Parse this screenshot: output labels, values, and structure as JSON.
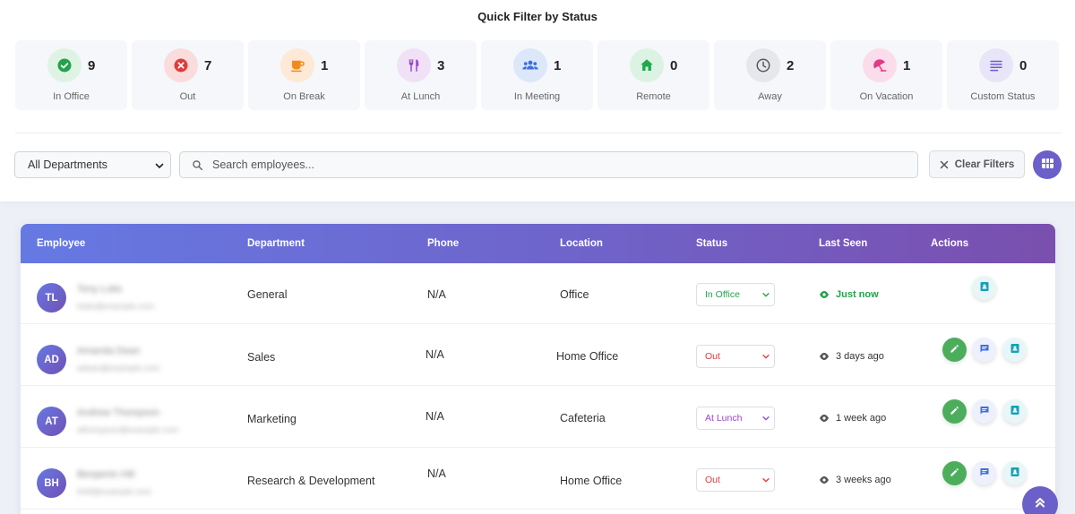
{
  "quick_filter": {
    "title": "Quick Filter by Status",
    "cards": [
      {
        "label": "In Office",
        "count": "9",
        "icon": "check-circle-icon",
        "bg": "#dff3e4",
        "fg": "#22a34a"
      },
      {
        "label": "Out",
        "count": "7",
        "icon": "x-circle-icon",
        "bg": "#fadcdc",
        "fg": "#e03b3b"
      },
      {
        "label": "On Break",
        "count": "1",
        "icon": "coffee-icon",
        "bg": "#fde9d6",
        "fg": "#f28a1b"
      },
      {
        "label": "At Lunch",
        "count": "3",
        "icon": "utensils-icon",
        "bg": "#f0e1f7",
        "fg": "#9b45c9"
      },
      {
        "label": "In Meeting",
        "count": "1",
        "icon": "users-icon",
        "bg": "#dde7fa",
        "fg": "#3b6fe0"
      },
      {
        "label": "Remote",
        "count": "0",
        "icon": "home-icon",
        "bg": "#dcf3e4",
        "fg": "#1fa84d"
      },
      {
        "label": "Away",
        "count": "2",
        "icon": "clock-icon",
        "bg": "#e5e7ea",
        "fg": "#555a61"
      },
      {
        "label": "On Vacation",
        "count": "1",
        "icon": "umbrella-icon",
        "bg": "#fbdceb",
        "fg": "#e23a86"
      },
      {
        "label": "Custom Status",
        "count": "0",
        "icon": "list-icon",
        "bg": "#e9e5f8",
        "fg": "#6b5fc9"
      }
    ]
  },
  "filters": {
    "department_value": "All Departments",
    "search_placeholder": "Search employees...",
    "clear_label": "Clear Filters"
  },
  "table": {
    "headers": {
      "employee": "Employee",
      "department": "Department",
      "phone": "Phone",
      "location": "Location",
      "status": "Status",
      "last_seen": "Last Seen",
      "actions": "Actions"
    },
    "rows": [
      {
        "initials": "TL",
        "name": "Tony Luke",
        "email": "tluke@example.com",
        "department": "General",
        "phone": "N/A",
        "location": "Office",
        "status": "In Office",
        "status_color": "#22a34a",
        "last_seen": "Just now",
        "seen_color": "#22a34a",
        "actions": [
          "contact-card"
        ]
      },
      {
        "initials": "AD",
        "name": "Amanda Dean",
        "email": "adean@example.com",
        "department": "Sales",
        "phone": "N/A",
        "location": "Home Office",
        "status": "Out",
        "status_color": "#e03b3b",
        "last_seen": "3 days ago",
        "seen_color": "#333333",
        "actions": [
          "edit",
          "message",
          "contact-card"
        ]
      },
      {
        "initials": "AT",
        "name": "Andrew Thompson",
        "email": "athompson@example.com",
        "department": "Marketing",
        "phone": "N/A",
        "location": "Cafeteria",
        "status": "At Lunch",
        "status_color": "#9b45c9",
        "last_seen": "1 week ago",
        "seen_color": "#333333",
        "actions": [
          "edit",
          "message",
          "contact-card"
        ]
      },
      {
        "initials": "BH",
        "name": "Benjamin Hill",
        "email": "bhill@example.com",
        "department": "Research & Development",
        "phone": "N/A",
        "location": "Home Office",
        "status": "Out",
        "status_color": "#e03b3b",
        "last_seen": "3 weeks ago",
        "seen_color": "#333333",
        "actions": [
          "edit",
          "message",
          "contact-card"
        ]
      }
    ]
  },
  "colors": {
    "accent": "#6b5fc9",
    "header_gradient_start": "#6679e3",
    "header_gradient_end": "#7a4fae"
  }
}
